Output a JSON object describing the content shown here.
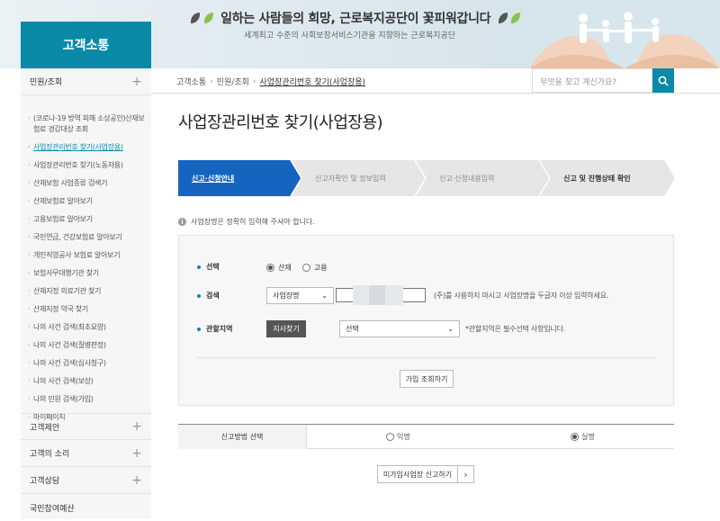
{
  "banner": {
    "title": "일하는 사람들의 희망, 근로복지공단이 꽃피워갑니다",
    "subtitle": "세계최고 수준의 사회보장서비스기관을 지향하는 근로복지공단"
  },
  "sidebar": {
    "heading": "고객소통",
    "top_item": "민원/조회",
    "sub_items": [
      "(코로나-19 방역 피해 소상공인)산재보험료 경감대상 조회",
      "사업장관리번호 찾기(사업장용)",
      "사업장관리번호 찾기(노동자용)",
      "산재보험 사업종류 검색기",
      "산재보험료 알아보기",
      "고용보험료 알아보기",
      "국민연금, 건강보험료 알아보기",
      "개인직영공사 보험료 알아보기",
      "보험사무대행기관 찾기",
      "산재지정 의료기관 찾기",
      "산재지정 약국 찾기",
      "나의 사건 검색(최초요양)",
      "나의 사건 검색(질병판정)",
      "나의 사건 검색(심사청구)",
      "나의 사건 검색(보상)",
      "나의 민원 검색(가입)",
      "마이페이지"
    ],
    "bottom_items": [
      "고객제안",
      "고객의 소리",
      "고객상담",
      "국민참여예산"
    ]
  },
  "breadcrumb": {
    "home": "고객소통",
    "section": "민원/조회",
    "current": "사업장관리번호 찾기(사업장용)"
  },
  "search": {
    "placeholder": "무엇을 찾고 계신가요?"
  },
  "page_title": "사업장관리번호 찾기(사업장용)",
  "steps": [
    "신고·신청안내",
    "신고자확인 및 정보입력",
    "신고·신청내용입력",
    "신고 및 진행상태 확인"
  ],
  "notice": "사업장명은 정확히 입력해 주셔야 합니다.",
  "form": {
    "select_label": "선택",
    "radio_options": [
      "산재",
      "고용"
    ],
    "search_label": "검색",
    "search_type": "사업장명",
    "search_hint": "(주)를 사용하지 마시고 사업장명을 두글자 이상 입력하세요.",
    "region_label": "관할지역",
    "branch_button": "지사찾기",
    "region_select": "선택",
    "region_hint": "*관할지역은 필수선택 사항입니다.",
    "lookup_button": "가입 조회하기"
  },
  "method": {
    "label": "신고방법 선택",
    "options": [
      "익명",
      "실명"
    ],
    "selected": "실명"
  },
  "report_button": "미가입사업장 신고하기",
  "colors": {
    "accent": "#0b8aa8",
    "step_active": "#1565c0"
  }
}
